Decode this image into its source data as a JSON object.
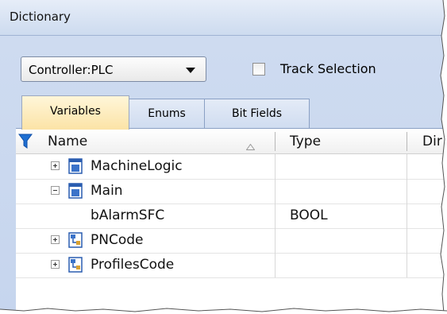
{
  "window": {
    "title": "Dictionary"
  },
  "controller_select": {
    "value": "Controller:PLC"
  },
  "track_selection": {
    "label": "Track Selection",
    "checked": false
  },
  "tabs": [
    {
      "label": "Variables",
      "active": true
    },
    {
      "label": "Enums",
      "active": false
    },
    {
      "label": "Bit Fields",
      "active": false
    }
  ],
  "grid": {
    "columns": [
      {
        "label": "Name",
        "sorted": "ascending"
      },
      {
        "label": "Type"
      },
      {
        "label": "Dir"
      }
    ],
    "rows": [
      {
        "name": "MachineLogic",
        "type": "",
        "icon": "program-icon",
        "expander": "plus",
        "level": 0
      },
      {
        "name": "Main",
        "type": "",
        "icon": "program-icon",
        "expander": "minus",
        "level": 0
      },
      {
        "name": "bAlarmSFC",
        "type": "BOOL",
        "icon": "",
        "expander": "none",
        "level": 1
      },
      {
        "name": "PNCode",
        "type": "",
        "icon": "sfc-program-icon",
        "expander": "plus",
        "level": 0
      },
      {
        "name": "ProfilesCode",
        "type": "",
        "icon": "sfc-program-icon",
        "expander": "plus",
        "level": 0
      }
    ]
  },
  "colors": {
    "panel_bg": "#c6d5ee",
    "active_tab": "#fbe3a6",
    "filter_icon": "#1f6fd1"
  }
}
